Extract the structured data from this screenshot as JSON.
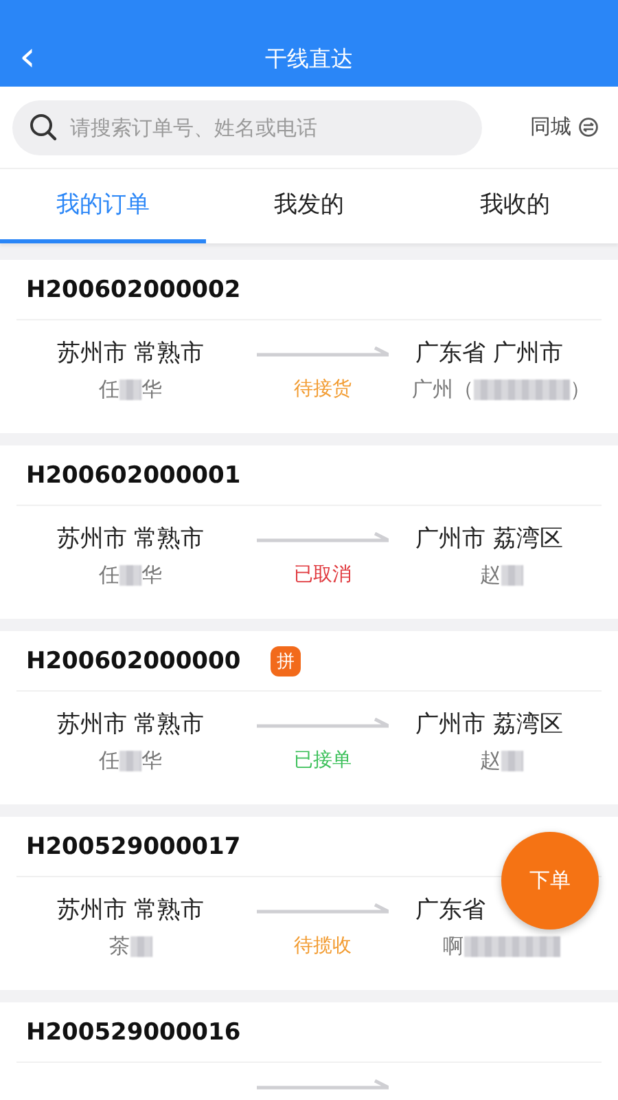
{
  "header": {
    "back": "‹",
    "title": "干线直达"
  },
  "search": {
    "placeholder": "请搜索订单号、姓名或电话",
    "city_switch": "同城"
  },
  "tabs": [
    {
      "label": "我的订单",
      "selected": true
    },
    {
      "label": "我发的",
      "selected": false
    },
    {
      "label": "我收的",
      "selected": false
    }
  ],
  "orders": [
    {
      "order_no": "H200602000002",
      "combined": false,
      "from": "苏州市 常熟市",
      "sender": [
        {
          "text": "任"
        },
        {
          "kind": "masked"
        },
        {
          "text": "华"
        }
      ],
      "to": "广东省 广州市",
      "receiver": [
        {
          "text": "广州（"
        },
        {
          "kind": "masked",
          "wide": true
        },
        {
          "text": "）"
        }
      ],
      "status": "待接货",
      "color": "#f29b30"
    },
    {
      "order_no": "H200602000001",
      "combined": false,
      "from": "苏州市 常熟市",
      "sender": [
        {
          "text": "任"
        },
        {
          "kind": "masked"
        },
        {
          "text": "华"
        }
      ],
      "to": "广州市 荔湾区",
      "receiver": [
        {
          "text": "赵"
        },
        {
          "kind": "masked"
        }
      ],
      "status": "已取消",
      "color": "#e0393e"
    },
    {
      "order_no": "H200602000000",
      "combined": true,
      "badge": "拼",
      "from": "苏州市 常熟市",
      "sender": [
        {
          "text": "任"
        },
        {
          "kind": "masked"
        },
        {
          "text": "华"
        }
      ],
      "to": "广州市 荔湾区",
      "receiver": [
        {
          "text": "赵"
        },
        {
          "kind": "masked"
        }
      ],
      "status": "已接单",
      "color": "#3cc05a"
    },
    {
      "order_no": "H200529000017",
      "combined": false,
      "from": "苏州市 常熟市",
      "sender": [
        {
          "text": "茶"
        },
        {
          "kind": "masked"
        }
      ],
      "to": "广东省",
      "receiver": [
        {
          "text": "啊"
        },
        {
          "kind": "masked",
          "wide": true
        }
      ],
      "status": "待揽收",
      "color": "#f29b30"
    },
    {
      "order_no": "H200529000016",
      "combined": false
    }
  ],
  "fab": {
    "label": "下单"
  }
}
